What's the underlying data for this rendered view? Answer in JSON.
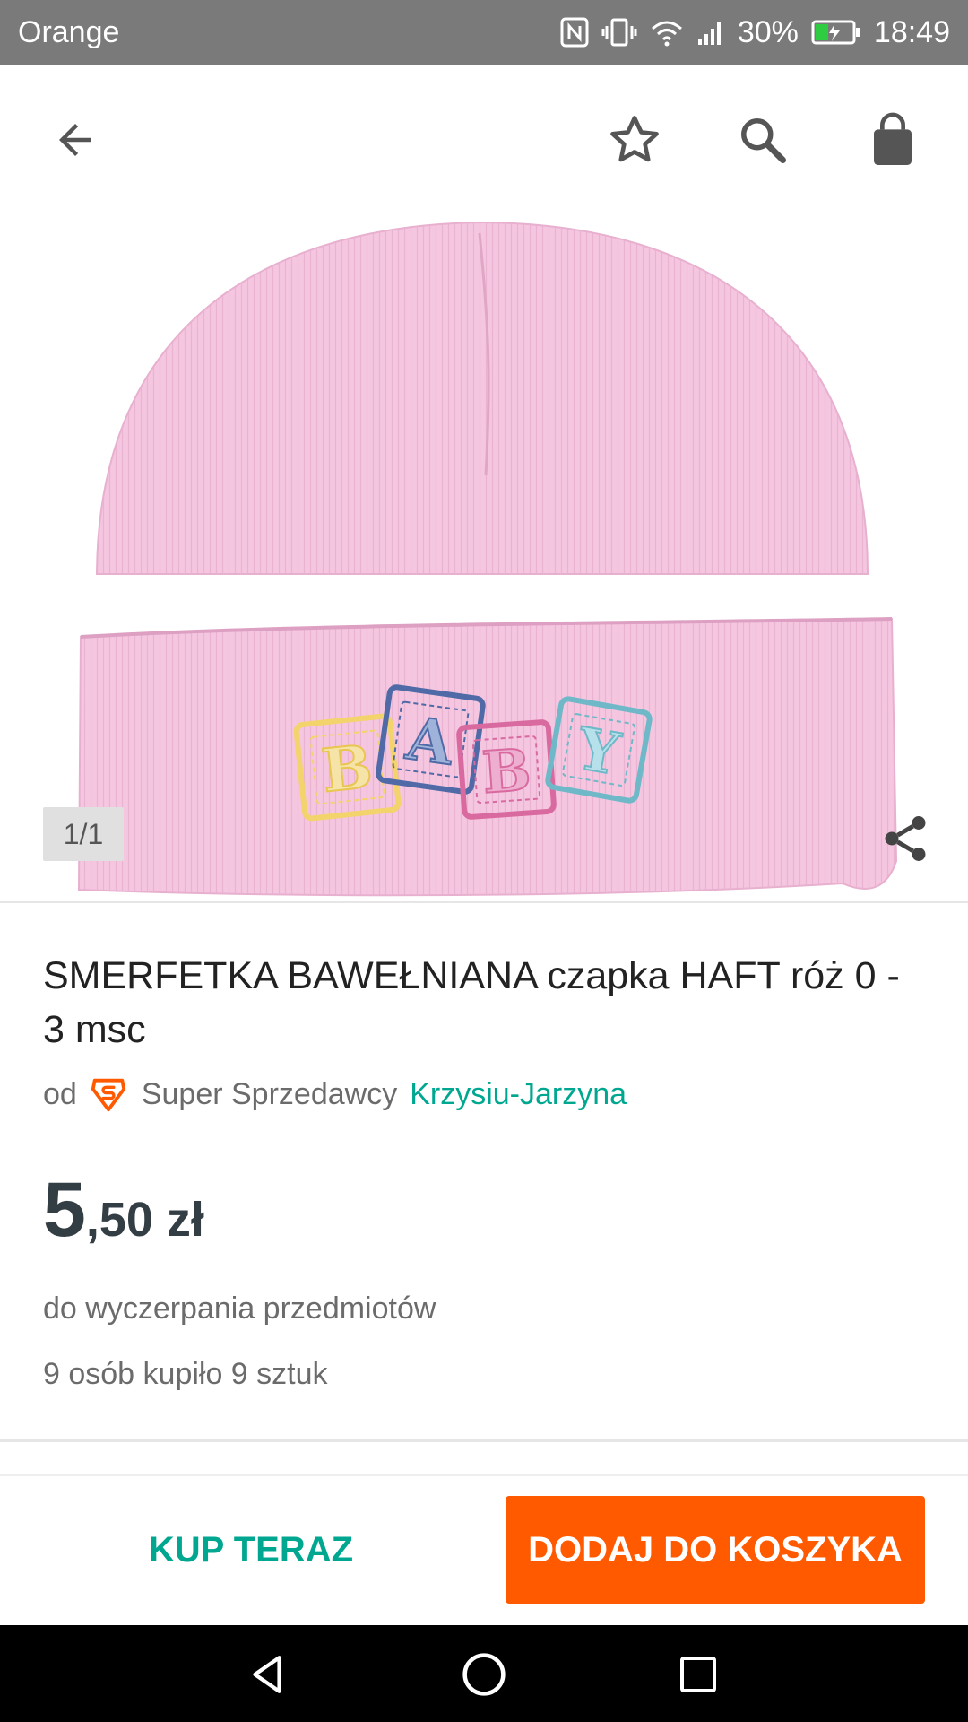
{
  "status_bar": {
    "carrier": "Orange",
    "battery": "30%",
    "time": "18:49"
  },
  "app_bar": {
    "icons": [
      "back-arrow-icon",
      "star-icon",
      "search-icon",
      "shopping-bag-icon"
    ]
  },
  "gallery": {
    "counter": "1/1",
    "image_text": "BABY"
  },
  "product": {
    "title": "SMERFETKA BAWEŁNIANA czapka HAFT róż 0 - 3 msc",
    "seller_prefix": "od",
    "seller_badge": "Super Sprzedawcy",
    "seller_name": "Krzysiu-Jarzyna",
    "price_major": "5",
    "price_minor": ",50 zł",
    "availability": "do wyczerpania przedmiotów",
    "sold_info": "9 osób kupiło 9 sztuk"
  },
  "actions": {
    "buy_now": "KUP TERAZ",
    "add_to_cart": "DODAJ DO KOSZYKA"
  },
  "colors": {
    "accent_teal": "#00a790",
    "accent_orange": "#ff5a00",
    "status_bar": "#7a7a7a",
    "hat_pink": "#f5c6e0"
  }
}
